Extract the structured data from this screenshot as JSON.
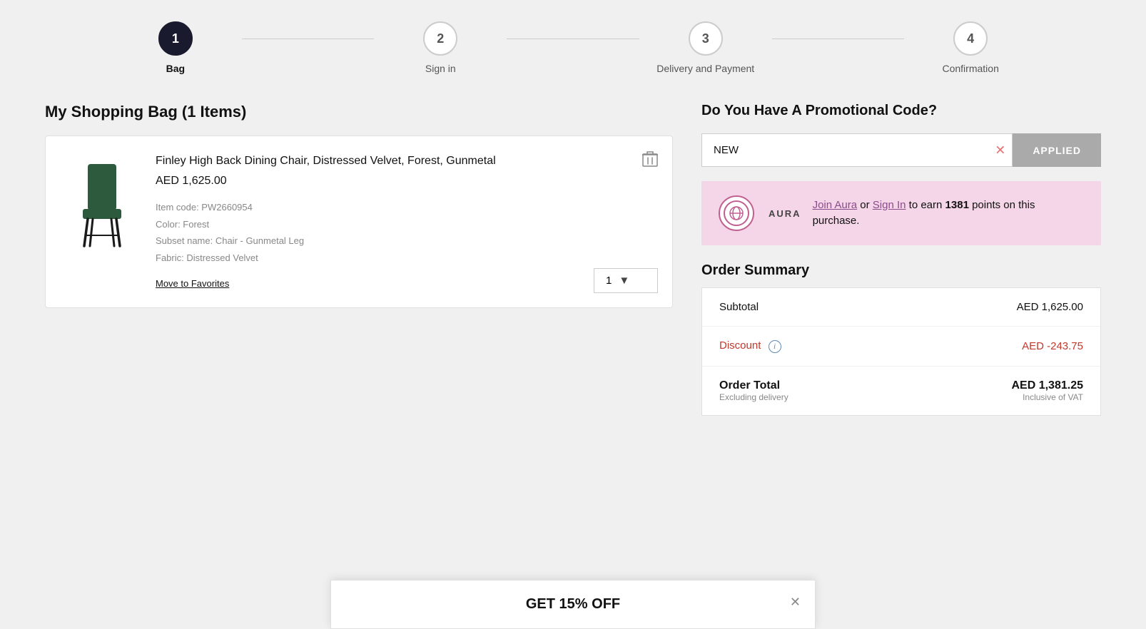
{
  "stepper": {
    "steps": [
      {
        "number": "1",
        "label": "Bag",
        "active": true
      },
      {
        "number": "2",
        "label": "Sign in",
        "active": false
      },
      {
        "number": "3",
        "label": "Delivery and Payment",
        "active": false
      },
      {
        "number": "4",
        "label": "Confirmation",
        "active": false
      }
    ]
  },
  "shopping_bag": {
    "title": "My Shopping Bag (1 Items)",
    "item": {
      "name": "Finley High Back Dining Chair, Distressed Velvet, Forest, Gunmetal",
      "price": "AED  1,625.00",
      "item_code": "Item code: PW2660954",
      "color": "Color: Forest",
      "subset": "Subset name: Chair - Gunmetal Leg",
      "fabric": "Fabric: Distressed Velvet",
      "move_to_fav": "Move to Favorites",
      "quantity": "1"
    }
  },
  "promo": {
    "title": "Do You Have A Promotional Code?",
    "input_value": "NEW",
    "button_label": "APPLIED",
    "clear_icon": "✕"
  },
  "aura": {
    "brand_name": "AURA",
    "text_before_join": "",
    "join_label": "Join Aura",
    "or_text": " or ",
    "sign_in_label": "Sign In",
    "text_after": " to earn ",
    "points": "1381",
    "text_end": " points on this purchase."
  },
  "order_summary": {
    "title": "Order Summary",
    "subtotal_label": "Subtotal",
    "subtotal_value": "AED 1,625.00",
    "discount_label": "Discount",
    "discount_info_icon": "i",
    "discount_value": "AED -243.75",
    "total_label": "Order Total",
    "total_value": "AED 1,381.25",
    "excluding_delivery": "Excluding delivery",
    "inclusive_vat": "Inclusive of VAT"
  },
  "bottom_banner": {
    "text": "GET 15% OFF",
    "close_icon": "✕"
  }
}
